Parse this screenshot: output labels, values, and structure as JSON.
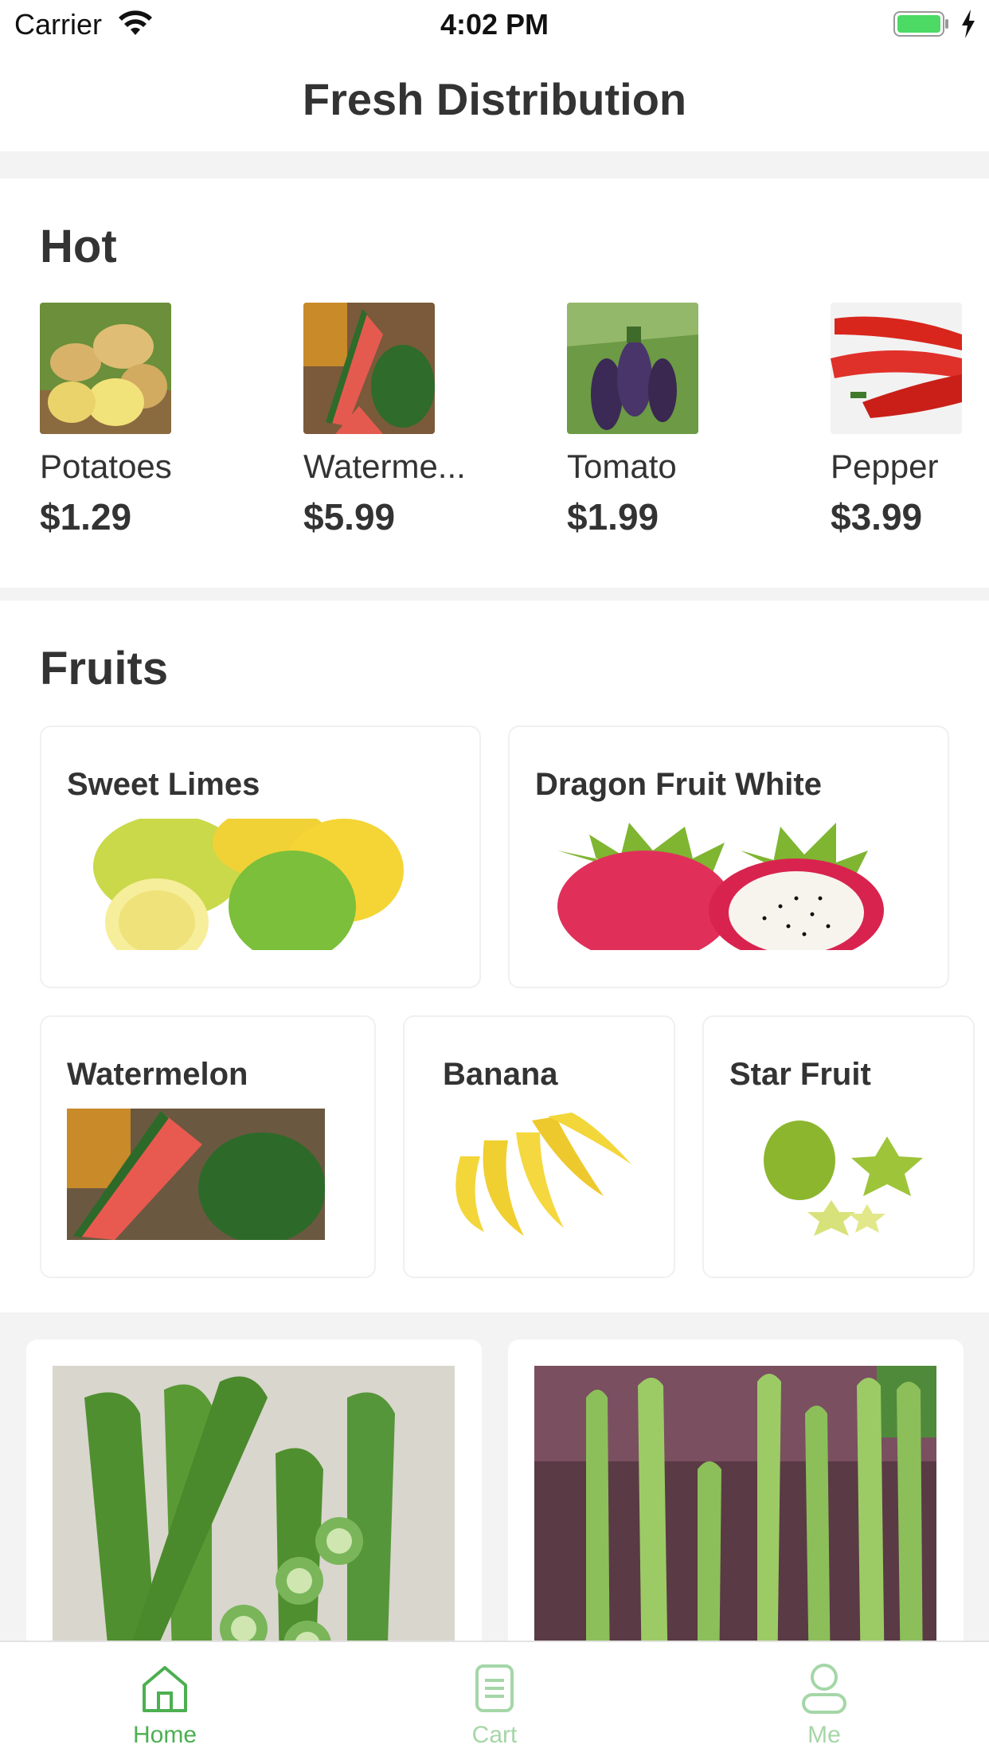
{
  "status": {
    "carrier": "Carrier",
    "time": "4:02 PM"
  },
  "nav": {
    "title": "Fresh Distribution"
  },
  "hot": {
    "title": "Hot",
    "items": [
      {
        "name": "Potatoes",
        "price": "$1.29",
        "icon": "potatoes-image"
      },
      {
        "name": "Waterme...",
        "price": "$5.99",
        "icon": "watermelon-image"
      },
      {
        "name": "Tomato",
        "price": "$1.99",
        "icon": "eggplant-image"
      },
      {
        "name": "Pepper",
        "price": "$3.99",
        "icon": "pepper-image"
      }
    ]
  },
  "fruits": {
    "title": "Fruits",
    "cards": [
      {
        "name": "Sweet Limes",
        "icon": "sweet-limes-image"
      },
      {
        "name": "Dragon Fruit White",
        "icon": "dragon-fruit-image"
      },
      {
        "name": "Watermelon",
        "icon": "watermelon-image"
      },
      {
        "name": "Banana",
        "icon": "banana-image"
      },
      {
        "name": "Star Fruit",
        "icon": "star-fruit-image"
      }
    ]
  },
  "vegetables": {
    "images": [
      "okra-image",
      "asparagus-image"
    ]
  },
  "tabs": [
    {
      "label": "Home",
      "icon": "home-icon",
      "active": true
    },
    {
      "label": "Cart",
      "icon": "cart-icon",
      "active": false
    },
    {
      "label": "Me",
      "icon": "profile-icon",
      "active": false
    }
  ],
  "colors": {
    "accent": "#4caf50",
    "inactive_tab": "#a5d6a7",
    "separator": "#f3f3f3",
    "battery": "#4cd964"
  }
}
